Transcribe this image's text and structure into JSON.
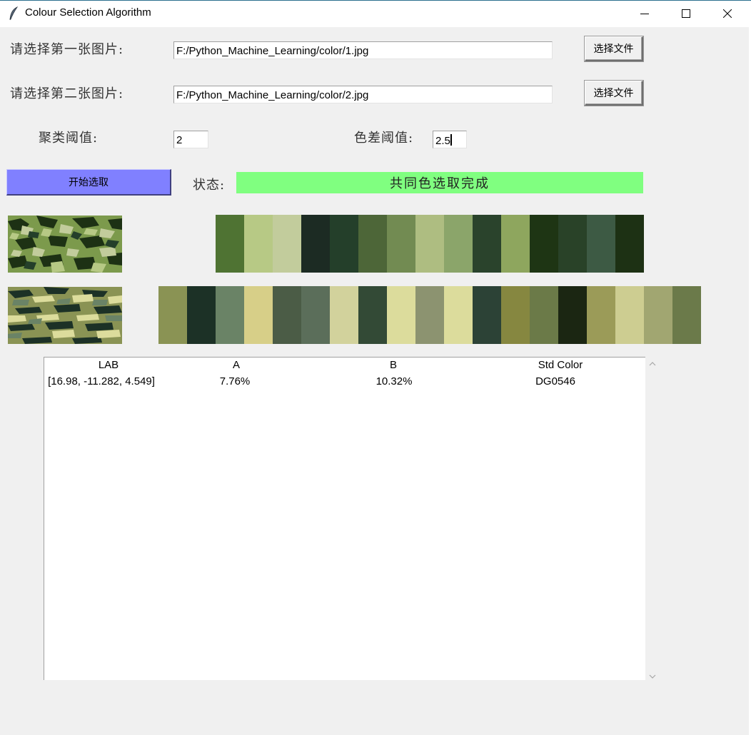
{
  "window": {
    "title": "Colour Selection Algorithm",
    "icon": "feather-icon",
    "controls": [
      "minimize-icon",
      "maximize-icon",
      "close-icon"
    ]
  },
  "form": {
    "first_label": "请选择第一张图片:",
    "first_path": "F:/Python_Machine_Learning/color/1.jpg",
    "second_label": "请选择第二张图片:",
    "second_path": "F:/Python_Machine_Learning/color/2.jpg",
    "browse_label": "选择文件",
    "cluster_label": "聚类阈值:",
    "cluster_value": "2",
    "diff_label": "色差阈值:",
    "diff_value": "2.5",
    "start_label": "开始选取",
    "status_label": "状态:",
    "status_value": "共同色选取完成"
  },
  "colors": {
    "start_button": "#8080ff",
    "status_bg": "#80ff80"
  },
  "palette1": [
    "#4f7333",
    "#b7c985",
    "#c2cc9c",
    "#1c2b23",
    "#243f2a",
    "#4d6638",
    "#728b52",
    "#aebd81",
    "#8ba56a",
    "#2a432c",
    "#8ea65e",
    "#1e3514",
    "#294228",
    "#3d5a44",
    "#1d3114"
  ],
  "palette2": [
    "#8a9354",
    "#1c3126",
    "#6a8366",
    "#d7cf88",
    "#4b5c46",
    "#5b6e5a",
    "#d2d29c",
    "#334a36",
    "#dcdc9c",
    "#8c9370",
    "#dcdc9c",
    "#2c4236",
    "#868740",
    "#6b7a48",
    "#1b2612",
    "#9b9b58",
    "#cdcd91",
    "#a1a671",
    "#6b7a4a"
  ],
  "table": {
    "headers": [
      "LAB",
      "A",
      "B",
      "Std Color"
    ],
    "rows": [
      [
        "[16.98, -11.282, 4.549]",
        "7.76%",
        "10.32%",
        "DG0546"
      ]
    ]
  }
}
